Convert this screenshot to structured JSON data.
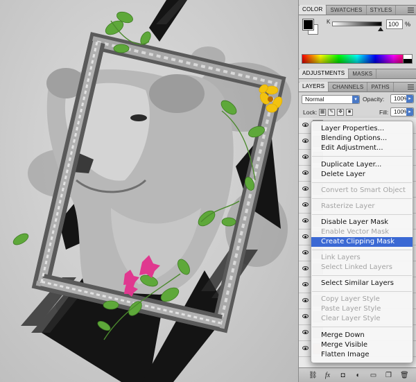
{
  "color_panel": {
    "tabs": [
      "COLOR",
      "SWATCHES",
      "STYLES"
    ],
    "channel_label": "K",
    "channel_value": "100",
    "channel_unit": "%"
  },
  "adjustments_panel": {
    "tabs": [
      "ADJUSTMENTS",
      "MASKS"
    ]
  },
  "layers_panel": {
    "tabs": [
      "LAYERS",
      "CHANNELS",
      "PATHS"
    ],
    "blend_mode": "Normal",
    "opacity_label": "Opacity:",
    "opacity_value": "100%",
    "lock_label": "Lock:",
    "fill_label": "Fill:",
    "fill_value": "100%"
  },
  "context_menu": {
    "items": [
      {
        "label": "Layer Properties...",
        "enabled": true
      },
      {
        "label": "Blending Options...",
        "enabled": true
      },
      {
        "label": "Edit Adjustment...",
        "enabled": true
      },
      {
        "label": "Duplicate Layer...",
        "enabled": true
      },
      {
        "label": "Delete Layer",
        "enabled": true
      },
      {
        "label": "Convert to Smart Object",
        "enabled": false
      },
      {
        "label": "Rasterize Layer",
        "enabled": false
      },
      {
        "label": "Disable Layer Mask",
        "enabled": true
      },
      {
        "label": "Enable Vector Mask",
        "enabled": false
      },
      {
        "label": "Create Clipping Mask",
        "enabled": true,
        "highlighted": true
      },
      {
        "label": "Link Layers",
        "enabled": false
      },
      {
        "label": "Select Linked Layers",
        "enabled": false
      },
      {
        "label": "Select Similar Layers",
        "enabled": true
      },
      {
        "label": "Copy Layer Style",
        "enabled": false
      },
      {
        "label": "Paste Layer Style",
        "enabled": false
      },
      {
        "label": "Clear Layer Style",
        "enabled": false
      },
      {
        "label": "Merge Down",
        "enabled": true
      },
      {
        "label": "Merge Visible",
        "enabled": true
      },
      {
        "label": "Flatten Image",
        "enabled": true
      }
    ]
  },
  "bottom_bar_icons": [
    "link-icon",
    "fx-icon",
    "mask-icon",
    "adjustment-icon",
    "group-icon",
    "new-layer-icon",
    "trash-icon"
  ],
  "colors": {
    "highlight": "#3b69d4",
    "flower_pink": "#e0388f",
    "flower_yellow": "#f2c20f",
    "leaf_green": "#5ea83a"
  }
}
